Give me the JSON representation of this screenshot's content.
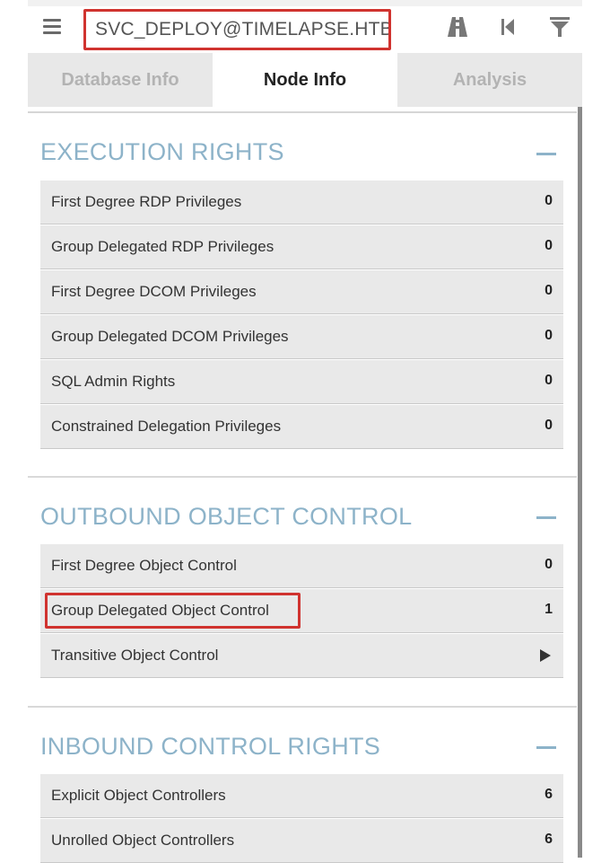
{
  "search": {
    "value": "SVC_DEPLOY@TIMELAPSE.HTB"
  },
  "toolbar": {
    "icons": [
      "menu-icon",
      "pathfinding-icon",
      "back-icon",
      "filter-icon"
    ]
  },
  "tabs": [
    {
      "label": "Database Info",
      "active": false
    },
    {
      "label": "Node Info",
      "active": true
    },
    {
      "label": "Analysis",
      "active": false
    }
  ],
  "sections": [
    {
      "title": "EXECUTION RIGHTS",
      "rows": [
        {
          "label": "First Degree RDP Privileges",
          "value": "0"
        },
        {
          "label": "Group Delegated RDP Privileges",
          "value": "0"
        },
        {
          "label": "First Degree DCOM Privileges",
          "value": "0"
        },
        {
          "label": "Group Delegated DCOM Privileges",
          "value": "0"
        },
        {
          "label": "SQL Admin Rights",
          "value": "0"
        },
        {
          "label": "Constrained Delegation Privileges",
          "value": "0"
        }
      ]
    },
    {
      "title": "OUTBOUND OBJECT CONTROL",
      "rows": [
        {
          "label": "First Degree Object Control",
          "value": "0"
        },
        {
          "label": "Group Delegated Object Control",
          "value": "1"
        },
        {
          "label": "Transitive Object Control",
          "value": ""
        }
      ]
    },
    {
      "title": "INBOUND CONTROL RIGHTS",
      "rows": [
        {
          "label": "Explicit Object Controllers",
          "value": "6"
        },
        {
          "label": "Unrolled Object Controllers",
          "value": "6"
        }
      ]
    }
  ],
  "colors": {
    "section_title": "#8db3c9",
    "highlight": "#d0332f",
    "row_bg": "#e9e9e9"
  }
}
